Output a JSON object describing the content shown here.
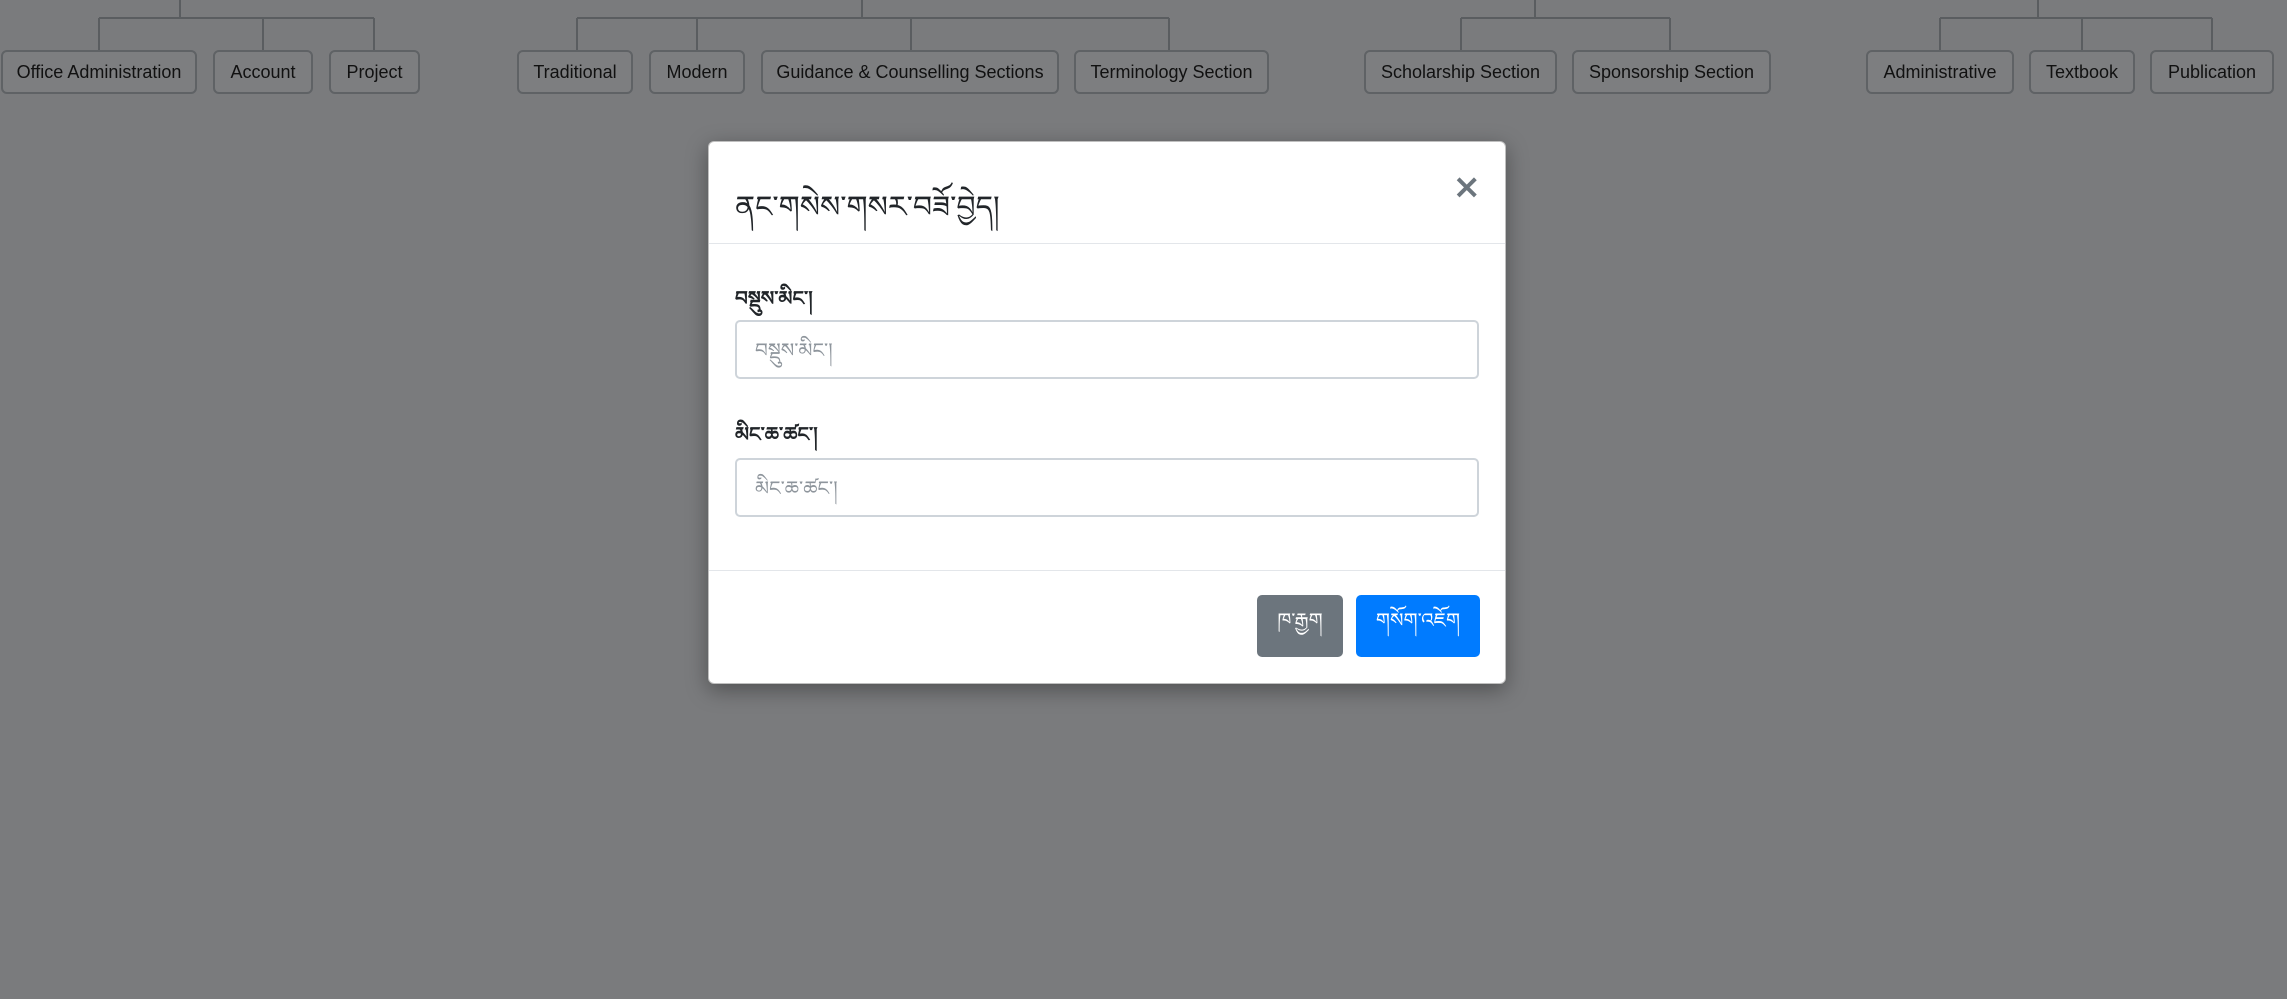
{
  "org_chart": {
    "groups": [
      {
        "items": [
          "Office Administration",
          "Account",
          "Project"
        ]
      },
      {
        "items": [
          "Traditional",
          "Modern",
          "Guidance & Counselling Sections",
          "Terminology Section"
        ]
      },
      {
        "items": [
          "Scholarship Section",
          "Sponsorship Section"
        ]
      },
      {
        "items": [
          "Administrative",
          "Textbook",
          "Publication"
        ]
      }
    ]
  },
  "modal": {
    "title": "ནང་གསེས་གསར་བཟོ་བྱེད།",
    "close_icon": "×",
    "fields": [
      {
        "label": "བསྡུས་མིང་།",
        "placeholder": "བསྡུས་མིང་།",
        "value": ""
      },
      {
        "label": "མིང་ཆ་ཚང་།",
        "placeholder": "མིང་ཆ་ཚང་།",
        "value": ""
      }
    ],
    "buttons": {
      "close": "ཁ་རྒྱག",
      "submit": "གསོག་འཇོག"
    },
    "colors": {
      "primary": "#007bff",
      "secondary": "#6c757d",
      "backdrop": "#7a7b7d"
    }
  }
}
